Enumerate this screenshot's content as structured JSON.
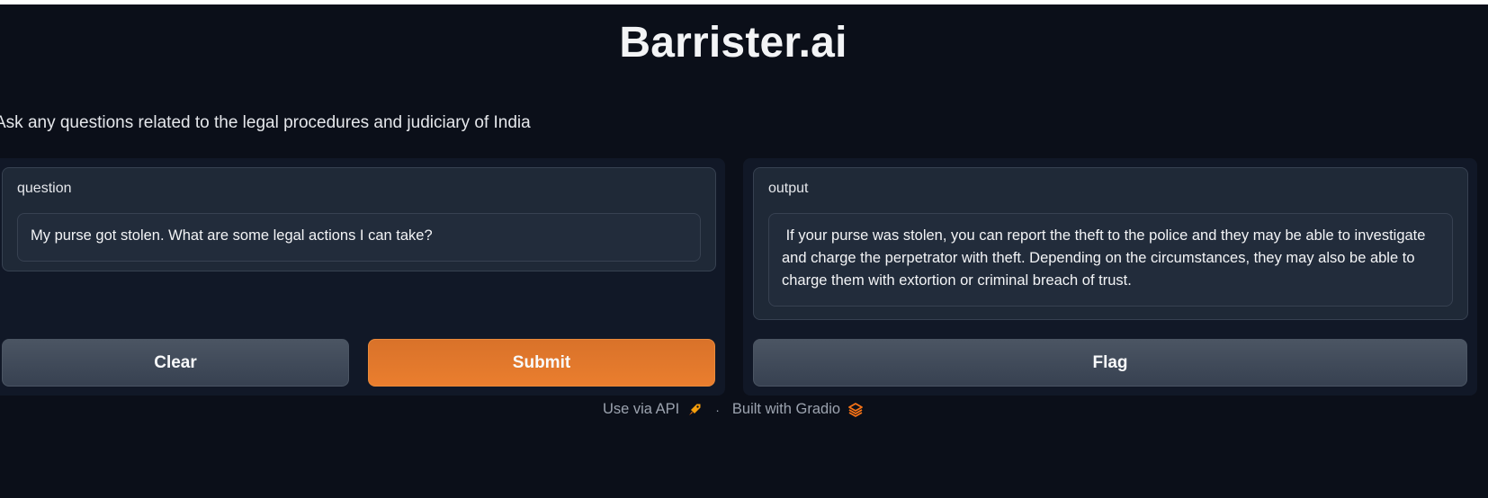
{
  "app": {
    "title": "Barrister.ai",
    "description": "Ask any questions related to the legal procedures and judiciary of India"
  },
  "input_panel": {
    "label": "question",
    "value": "My purse got stolen. What are some legal actions I can take?",
    "clear_label": "Clear",
    "submit_label": "Submit"
  },
  "output_panel": {
    "label": "output",
    "value": " If your purse was stolen, you can report the theft to the police and they may be able to investigate and charge the perpetrator with theft. Depending on the circumstances, they may also be able to charge them with extortion or criminal breach of trust.",
    "flag_label": "Flag"
  },
  "footer": {
    "api_label": "Use via API",
    "api_icon": "rocket-icon",
    "separator": "·",
    "built_label": "Built with Gradio",
    "gradio_icon": "gradio-logo-icon"
  },
  "colors": {
    "background": "#0b0f19",
    "panel": "#111827",
    "block": "#1f2937",
    "primary": "#ea7e2e",
    "secondary": "#4b5563"
  }
}
